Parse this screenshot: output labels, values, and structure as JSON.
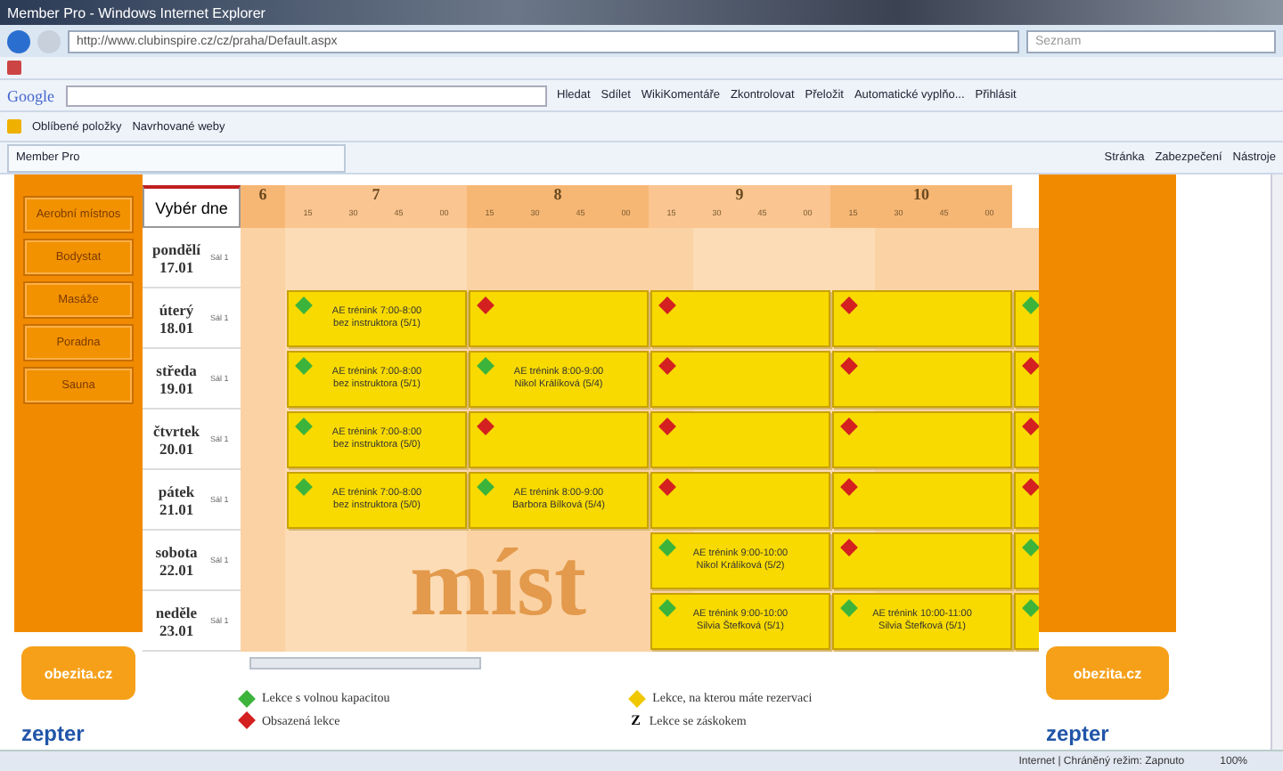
{
  "browser": {
    "title": "Member Pro - Windows Internet Explorer",
    "url": "http://www.clubinspire.cz/cz/praha/Default.aspx",
    "search_placeholder": "Seznam",
    "google_logo": "Google",
    "google_tools": [
      "Hledat",
      "Sdílet",
      "WikiKomentáře",
      "Zkontrolovat",
      "Přeložit",
      "Automatické vyplňo...",
      "Přihlásit"
    ],
    "favorites": [
      "Oblíbené položky",
      "Navrhované weby"
    ],
    "tab": "Member Pro",
    "commands": [
      "Stránka",
      "Zabezpečení",
      "Nástroje"
    ]
  },
  "menu": [
    "Aerobní místnos",
    "Bodystat",
    "Masáže",
    "Poradna",
    "Sauna"
  ],
  "day_picker": "Vybér dne",
  "hours": [
    {
      "label": "6"
    },
    {
      "label": "7",
      "ticks": [
        "15",
        "30",
        "45",
        "00"
      ]
    },
    {
      "label": "8",
      "ticks": [
        "15",
        "30",
        "45",
        "00"
      ]
    },
    {
      "label": "9",
      "ticks": [
        "15",
        "30",
        "45",
        "00"
      ]
    },
    {
      "label": "10",
      "ticks": [
        "15",
        "30",
        "45",
        "00"
      ]
    }
  ],
  "watermark": "míst",
  "days": [
    {
      "name": "pondělí",
      "date": "17.01",
      "room": "Sál 1",
      "slots": [
        {
          "kind": "empty"
        },
        {
          "kind": "empty"
        },
        {
          "kind": "empty"
        },
        {
          "kind": "empty"
        },
        {
          "kind": "empty"
        }
      ]
    },
    {
      "name": "úterý",
      "date": "18.01",
      "room": "Sál 1",
      "slots": [
        {
          "kind": "free",
          "title": "AE trénink 7:00-8:00",
          "detail": "bez instruktora (5/1)"
        },
        {
          "kind": "full"
        },
        {
          "kind": "full"
        },
        {
          "kind": "full"
        },
        {
          "kind": "free"
        }
      ]
    },
    {
      "name": "středa",
      "date": "19.01",
      "room": "Sál 1",
      "slots": [
        {
          "kind": "free",
          "title": "AE trénink 7:00-8:00",
          "detail": "bez instruktora (5/1)"
        },
        {
          "kind": "free",
          "title": "AE trénink 8:00-9:00",
          "detail": "Nikol Králíková (5/4)"
        },
        {
          "kind": "full"
        },
        {
          "kind": "full"
        },
        {
          "kind": "full"
        }
      ]
    },
    {
      "name": "čtvrtek",
      "date": "20.01",
      "room": "Sál 1",
      "slots": [
        {
          "kind": "free",
          "title": "AE trénink 7:00-8:00",
          "detail": "bez instruktora (5/0)"
        },
        {
          "kind": "full"
        },
        {
          "kind": "full"
        },
        {
          "kind": "full"
        },
        {
          "kind": "full"
        }
      ]
    },
    {
      "name": "pátek",
      "date": "21.01",
      "room": "Sál 1",
      "slots": [
        {
          "kind": "free",
          "title": "AE trénink 7:00-8:00",
          "detail": "bez instruktora (5/0)"
        },
        {
          "kind": "free",
          "title": "AE trénink 8:00-9:00",
          "detail": "Barbora Bílková (5/4)"
        },
        {
          "kind": "full"
        },
        {
          "kind": "full"
        },
        {
          "kind": "full"
        }
      ]
    },
    {
      "name": "sobota",
      "date": "22.01",
      "room": "Sál 1",
      "slots": [
        {
          "kind": "empty"
        },
        {
          "kind": "empty"
        },
        {
          "kind": "free",
          "title": "AE trénink 9:00-10:00",
          "detail": "Nikol Králíková (5/2)"
        },
        {
          "kind": "full"
        },
        {
          "kind": "free"
        }
      ]
    },
    {
      "name": "neděle",
      "date": "23.01",
      "room": "Sál 1",
      "slots": [
        {
          "kind": "empty"
        },
        {
          "kind": "empty"
        },
        {
          "kind": "free",
          "title": "AE trénink 9:00-10:00",
          "detail": "Silvia Štefková (5/1)"
        },
        {
          "kind": "free",
          "title": "AE trénink 10:00-11:00",
          "detail": "Silvia Štefková (5/1)"
        },
        {
          "kind": "free"
        }
      ]
    }
  ],
  "legend": [
    {
      "kind": "free",
      "label": "Lekce s volnou kapacitou"
    },
    {
      "kind": "reserved",
      "label": "Lekce, na kterou máte rezervaci"
    },
    {
      "kind": "full",
      "label": "Obsazená lekce"
    },
    {
      "kind": "substitute",
      "mark": "Z",
      "label": "Lekce se záskokem"
    }
  ],
  "left_logos": [
    "obezita.cz",
    "zepter"
  ],
  "right_logos": [
    "obezita.cz",
    "zepter"
  ],
  "status": {
    "text": "Internet | Chráněný režim: Zapnuto",
    "zoom": "100%"
  }
}
